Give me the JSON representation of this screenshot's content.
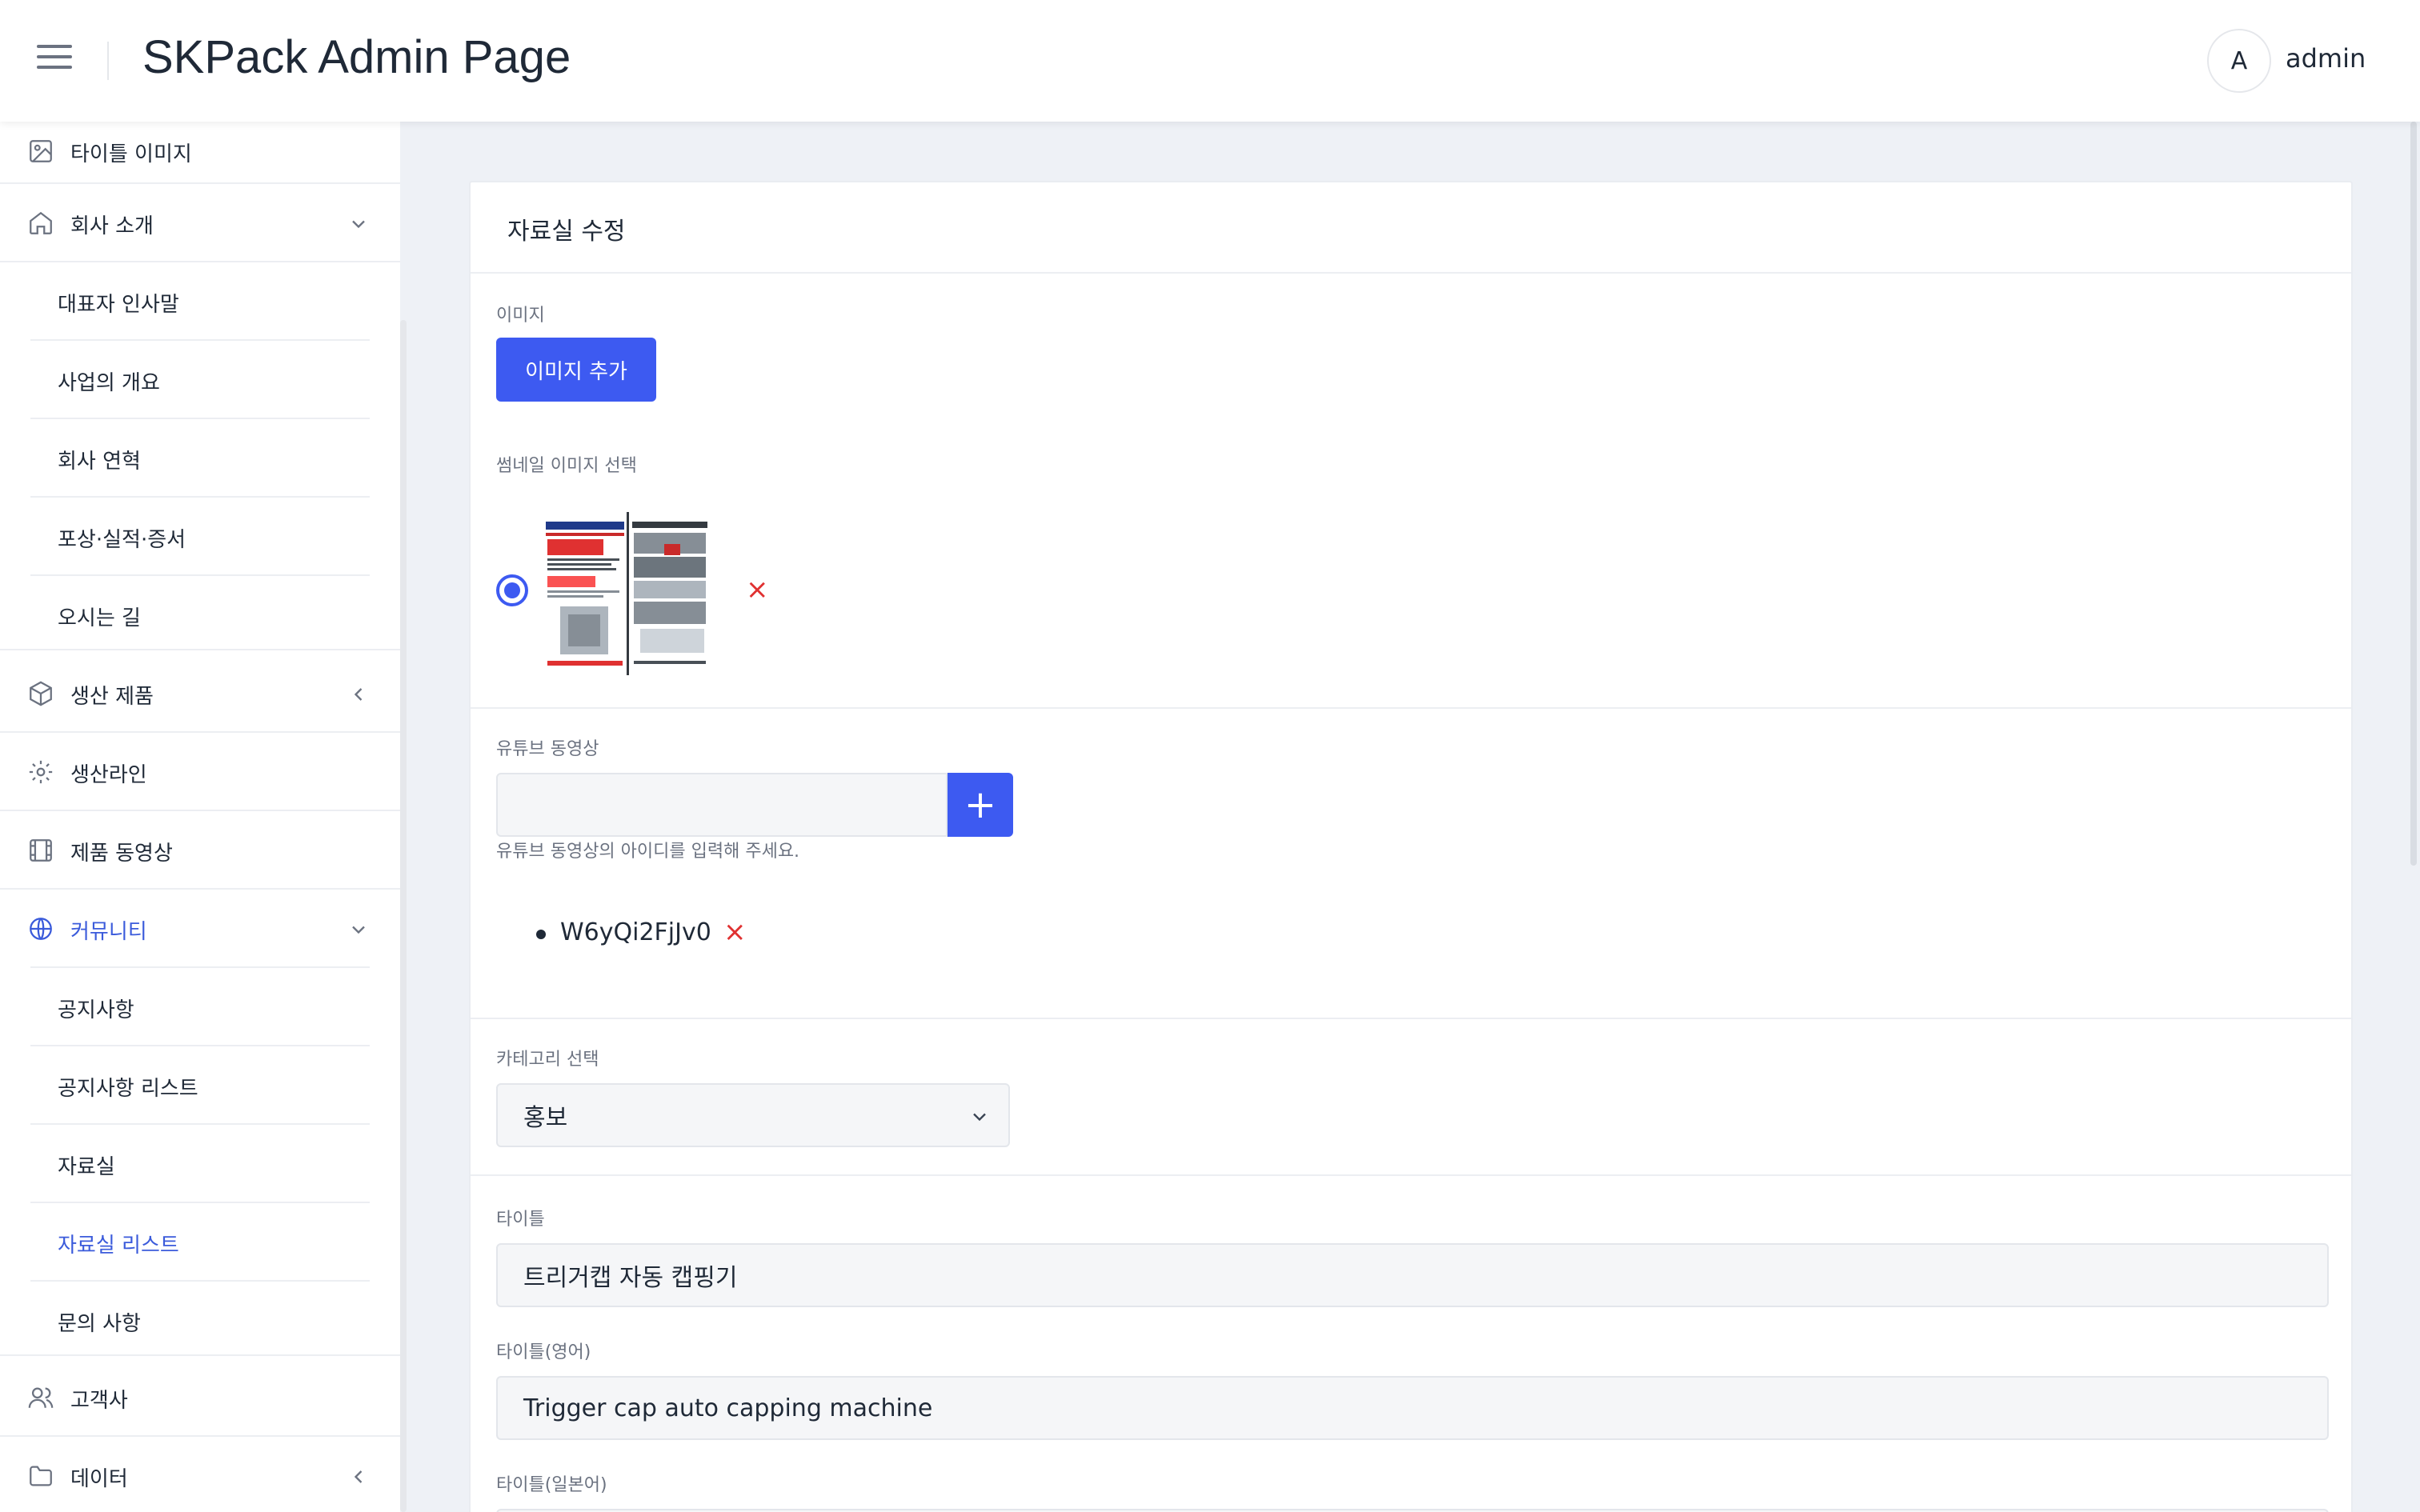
{
  "header": {
    "title": "SKPack Admin Page",
    "avatar_initial": "A",
    "username": "admin"
  },
  "sidebar": {
    "title_image": "타이틀 이미지",
    "company": "회사 소개",
    "company_sub": [
      "대표자 인사말",
      "사업의 개요",
      "회사 연혁",
      "포상·실적·증서",
      "오시는 길"
    ],
    "products": "생산 제품",
    "production_line": "생산라인",
    "product_video": "제품 동영상",
    "community": "커뮤니티",
    "community_sub": [
      "공지사항",
      "공지사항 리스트",
      "자료실",
      "자료실 리스트",
      "문의 사항"
    ],
    "clients": "고객사",
    "data": "데이터",
    "active_item": "자료실 리스트",
    "accent": "#3b5bdb"
  },
  "form": {
    "title": "자료실 수정",
    "image_label": "이미지",
    "image_add_button": "이미지 추가",
    "thumbnail_label": "썸네일 이미지 선택",
    "youtube_label": "유튜브 동영상",
    "youtube_help": "유튜브 동영상의 아이디를 입력해 주세요.",
    "youtube_input_value": "",
    "youtube_add_icon": "+",
    "youtube_ids": [
      "W6yQi2FjJv0"
    ],
    "category_label": "카테고리 선택",
    "category_value": "홍보",
    "title_label": "타이틀",
    "title_value": "트리거캡 자동 캡핑기",
    "title_en_label": "타이틀(영어)",
    "title_en_value": "Trigger cap auto capping machine",
    "title_ja_label": "타이틀(일본어)",
    "remove_icon": "×",
    "primary_color": "#3d5af1",
    "danger_color": "#e03131"
  }
}
